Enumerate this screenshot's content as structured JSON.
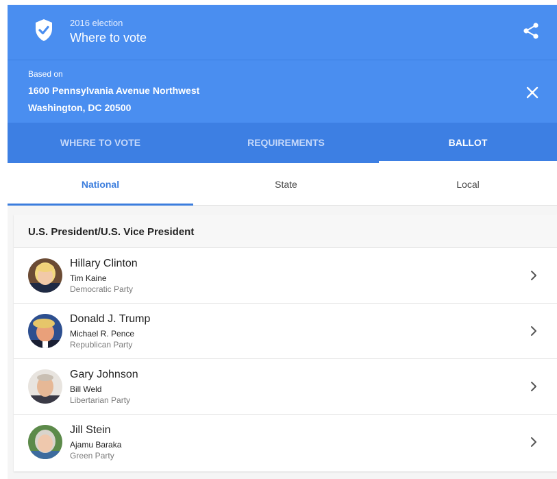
{
  "header": {
    "subtitle": "2016 election",
    "title": "Where to vote",
    "icons": {
      "badge": "verified-check-icon",
      "share": "share-icon"
    }
  },
  "address": {
    "based_on": "Based on",
    "line1": "1600 Pennsylvania Avenue Northwest",
    "line2": "Washington, DC 20500",
    "icons": {
      "close": "close-icon"
    }
  },
  "tabs": [
    {
      "label": "WHERE TO VOTE",
      "active": false
    },
    {
      "label": "REQUIREMENTS",
      "active": false
    },
    {
      "label": "BALLOT",
      "active": true
    }
  ],
  "subtabs": [
    {
      "label": "National",
      "active": true
    },
    {
      "label": "State",
      "active": false
    },
    {
      "label": "Local",
      "active": false
    }
  ],
  "race": {
    "title": "U.S. President/U.S. Vice President",
    "candidates": [
      {
        "name": "Hillary Clinton",
        "running_mate": "Tim Kaine",
        "party": "Democratic Party"
      },
      {
        "name": "Donald J. Trump",
        "running_mate": "Michael R. Pence",
        "party": "Republican Party"
      },
      {
        "name": "Gary Johnson",
        "running_mate": "Bill Weld",
        "party": "Libertarian Party"
      },
      {
        "name": "Jill Stein",
        "running_mate": "Ajamu Baraka",
        "party": "Green Party"
      }
    ]
  },
  "colors": {
    "header_blue": "#4a8ef0",
    "tab_bar_blue": "#3d7fe3",
    "active_subtab": "#3b7ddd"
  }
}
